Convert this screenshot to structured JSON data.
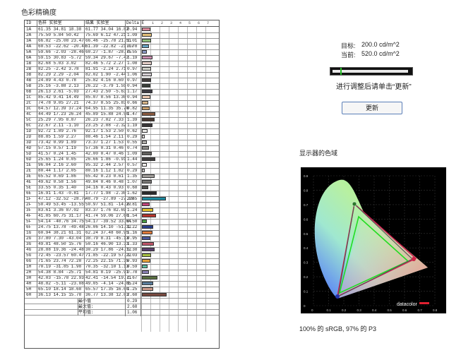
{
  "page_title": "色彩精确度",
  "table": {
    "headers": [
      "ID",
      "色样 实验室",
      "结果 实验室",
      "Delta E"
    ],
    "scale_ticks": [
      "1",
      "2",
      "3",
      "4",
      "5",
      "6",
      "7"
    ],
    "rows": [
      {
        "id": "1A",
        "ref": "61.35  34.81  18.38",
        "res": "61.77  34.04  16.82",
        "de": "0.94",
        "color": "#d98a9a"
      },
      {
        "id": "2A",
        "ref": "75.50   5.84  50.42",
        "res": "75.69   6.12  47.21",
        "de": "1.09",
        "color": "#e3c07a"
      },
      {
        "id": "3A",
        "ref": "66.82 -25.08  23.47",
        "res": "66.46 -25.78  21.51",
        "de": "1.01",
        "color": "#8fbf7a"
      },
      {
        "id": "4A",
        "ref": "60.53 -22.62 -20.40",
        "res": "61.39 -22.82 -21.07",
        "de": "0.78",
        "color": "#6aa6c4"
      },
      {
        "id": "5A",
        "ref": "59.66  -2.03 -28.46",
        "res": "60.27  -1.87 -28.75",
        "de": "0.55",
        "color": "#8c9ac6"
      },
      {
        "id": "6A",
        "ref": "59.15  30.83  -5.72",
        "res": "59.34  29.67  -7.42",
        "de": "1.19",
        "color": "#c88cae"
      },
      {
        "id": "1B",
        "ref": "82.68   5.03   3.02",
        "res": "82.46   5.72   2.27",
        "de": "1.08",
        "color": "#e3cdc6"
      },
      {
        "id": "2B",
        "ref": "82.25  -2.42   3.78",
        "res": "81.91  -2.24   2.71",
        "de": "0.97",
        "color": "#cfd0c8"
      },
      {
        "id": "3B",
        "ref": "82.29   2.29  -2.04",
        "res": "82.02   1.90  -2.44",
        "de": "1.06",
        "color": "#d6d0d4"
      },
      {
        "id": "4B",
        "ref": "24.89   4.43   0.78",
        "res": "25.82   4.16   0.60",
        "de": "0.97",
        "color": "#453f3d"
      },
      {
        "id": "5B",
        "ref": "25.16  -3.88   2.13",
        "res": "26.22  -3.79   1.55",
        "de": "0.94",
        "color": "#3a3f38"
      },
      {
        "id": "6B",
        "ref": "26.13   2.61  -5.03",
        "res": "27.43   2.50  -5.63",
        "de": "1.17",
        "color": "#3e3c45"
      },
      {
        "id": "1C",
        "ref": "85.42   9.41  14.49",
        "res": "85.07   8.56  13.30",
        "de": "0.94",
        "color": "#f0cdb5"
      },
      {
        "id": "2C",
        "ref": "74.78   9.05  27.21",
        "res": "74.37   8.55  25.83",
        "de": "0.66",
        "color": "#d8b588"
      },
      {
        "id": "3C",
        "ref": "64.57  12.39  37.24",
        "res": "64.95  11.35  35.70",
        "de": "0.82",
        "color": "#c99e6a"
      },
      {
        "id": "4C",
        "ref": "44.49  17.23  26.24",
        "res": "45.89  15.88  24.50",
        "de": "1.47",
        "color": "#8a5a3f"
      },
      {
        "id": "5C",
        "ref": "25.29   7.95   8.87",
        "res": "26.23   7.02   7.33",
        "de": "1.39",
        "color": "#4a3831"
      },
      {
        "id": "6C",
        "ref": "22.67   2.11  -1.10",
        "res": "23.25   2.08  -2.32",
        "de": "1.19",
        "color": "#383537"
      },
      {
        "id": "1D",
        "ref": "92.72   1.89   2.76",
        "res": "92.17   1.53   2.50",
        "de": "0.62",
        "color": "#ecebe8"
      },
      {
        "id": "2D",
        "ref": "88.85   1.59   2.27",
        "res": "88.46   1.54   2.11",
        "de": "0.29",
        "color": "#e0dcda"
      },
      {
        "id": "3D",
        "ref": "73.42   0.99   1.89",
        "res": "73.37   1.27   1.53",
        "de": "0.55",
        "color": "#b5b3af"
      },
      {
        "id": "4D",
        "ref": "57.15   0.57   1.19",
        "res": "57.36   0.31   0.46",
        "de": "0.74",
        "color": "#8b8a87"
      },
      {
        "id": "5D",
        "ref": "41.57   0.24   1.45",
        "res": "42.00   0.47   0.46",
        "de": "1.09",
        "color": "#62615e"
      },
      {
        "id": "6D",
        "ref": "25.65   1.24   0.05",
        "res": "26.66   1.86  -0.91",
        "de": "1.44",
        "color": "#3f3d3d"
      },
      {
        "id": "1E",
        "ref": "96.04   2.16   2.60",
        "res": "95.32   2.44   2.57",
        "de": "0.57",
        "color": "#f7f4f2"
      },
      {
        "id": "2E",
        "ref": "80.44   1.17   2.05",
        "res": "80.16   1.12   1.82",
        "de": "0.29",
        "color": "#cbc8c6"
      },
      {
        "id": "3E",
        "ref": "65.52   0.69   1.86",
        "res": "65.42   0.23   0.61",
        "de": "1.35",
        "color": "#a29f9c"
      },
      {
        "id": "4E",
        "ref": "49.62   0.58   1.56",
        "res": "49.84   0.46   0.48",
        "de": "1.07",
        "color": "#797775"
      },
      {
        "id": "5E",
        "ref": "33.55   0.35   1.40",
        "res": "34.16   0.43   0.93",
        "de": "0.68",
        "color": "#54524f"
      },
      {
        "id": "6E",
        "ref": "16.91   1.43  -0.81",
        "res": "17.77   1.98  -2.30",
        "de": "1.62",
        "color": "#2b2a2c"
      },
      {
        "id": "1F",
        "ref": "47.12 -32.52 -28.75",
        "res": "48.79 -27.89 -27.99",
        "de": "2.65",
        "color": "#1e8aa0"
      },
      {
        "id": "2F",
        "ref": "50.49  53.45 -13.55",
        "res": "50.97  51.81 -14.27",
        "de": "0.81",
        "color": "#c0447a"
      },
      {
        "id": "3F",
        "ref": "83.61   3.36  87.02",
        "res": "83.37   1.76  82.69",
        "de": "1.24",
        "color": "#e6c22a"
      },
      {
        "id": "4F",
        "ref": "41.05  60.75  31.17",
        "res": "41.74  59.06  27.60",
        "de": "1.54",
        "color": "#b8342c"
      },
      {
        "id": "5F",
        "ref": "54.14 -40.76  34.75",
        "res": "54.17 -39.52  33.64",
        "de": "0.50",
        "color": "#4aa044"
      },
      {
        "id": "6F",
        "ref": "24.75  13.78 -49.48",
        "res": "26.06  14.10 -51.32",
        "de": "1.22",
        "color": "#2a3f8e"
      },
      {
        "id": "1G",
        "ref": "60.94  38.21  61.31",
        "res": "62.24  37.48  60.95",
        "de": "1.16",
        "color": "#df7a3a"
      },
      {
        "id": "2G",
        "ref": "37.80   7.30 -43.04",
        "res": "38.79   8.31 -45.13",
        "de": "0.95",
        "color": "#4a5aa0"
      },
      {
        "id": "3G",
        "ref": "49.81  48.50  15.76",
        "res": "50.16  46.90  13.33",
        "de": "1.33",
        "color": "#c0566a"
      },
      {
        "id": "4G",
        "ref": "28.88  19.36 -24.48",
        "res": "30.29  17.86 -24.12",
        "de": "1.38",
        "color": "#5a3f6e"
      },
      {
        "id": "5G",
        "ref": "72.45 -23.57  60.47",
        "res": "71.85 -22.19  57.22",
        "de": "1.03",
        "color": "#a6c042"
      },
      {
        "id": "6G",
        "ref": "71.65  23.74  72.28",
        "res": "72.25  22.15  71.35",
        "de": "0.93",
        "color": "#e6a23a"
      },
      {
        "id": "1H",
        "ref": "70.19 -31.85   1.98",
        "res": "70.35 -32.10   1.13",
        "de": "0.59",
        "color": "#5ec0a0"
      },
      {
        "id": "2H",
        "ref": "54.38   8.84 -25.71",
        "res": "54.81   8.19 -25.91",
        "de": "0.78",
        "color": "#8a80b4"
      },
      {
        "id": "3H",
        "ref": "42.03 -15.78  22.93",
        "res": "42.41 -14.54  19.71",
        "de": "1.67",
        "color": "#5a7040"
      },
      {
        "id": "4H",
        "ref": "48.82  -5.11 -23.08",
        "res": "49.05  -4.14 -24.85",
        "de": "1.24",
        "color": "#5a7e9e"
      },
      {
        "id": "5H",
        "ref": "65.10  18.14  18.68",
        "res": "65.57  17.35  16.60",
        "de": "1.25",
        "color": "#cc9a8a"
      },
      {
        "id": "6H",
        "ref": "36.13  14.15  15.78",
        "res": "36.77  13.38  12.83",
        "de": "2.68",
        "color": "#7a4a40"
      }
    ],
    "summary": [
      {
        "label": "最小值",
        "value": "0.29"
      },
      {
        "label": "最大值:",
        "value": "2.68"
      },
      {
        "label": "平均值:",
        "value": "1.06"
      }
    ]
  },
  "calibration": {
    "target_label": "目标:",
    "target_value": "200.0 cd/m^2",
    "current_label": "当前:",
    "current_value": "520.0 cd/m^2",
    "target_fraction": 0.12,
    "hint": "进行调整后请单击“更新”",
    "update_button": "更新"
  },
  "gamut": {
    "title": "显示器的色域",
    "caption": "100% 的 sRGB, 97% 的 P3",
    "brand": "datacolor",
    "x_ticks": [
      "0",
      "0.1",
      "0.2",
      "0.3",
      "0.4",
      "0.5",
      "0.6",
      "0.7",
      "0.8"
    ],
    "y_ticks": [
      "0.9",
      "0.8",
      "0.7",
      "0.6",
      "0.5",
      "0.4",
      "0.3",
      "0.2",
      "0.1",
      "0"
    ],
    "colors": {
      "srgb": "#22dd22",
      "p3": "#d02050",
      "measured": "#444444"
    }
  }
}
